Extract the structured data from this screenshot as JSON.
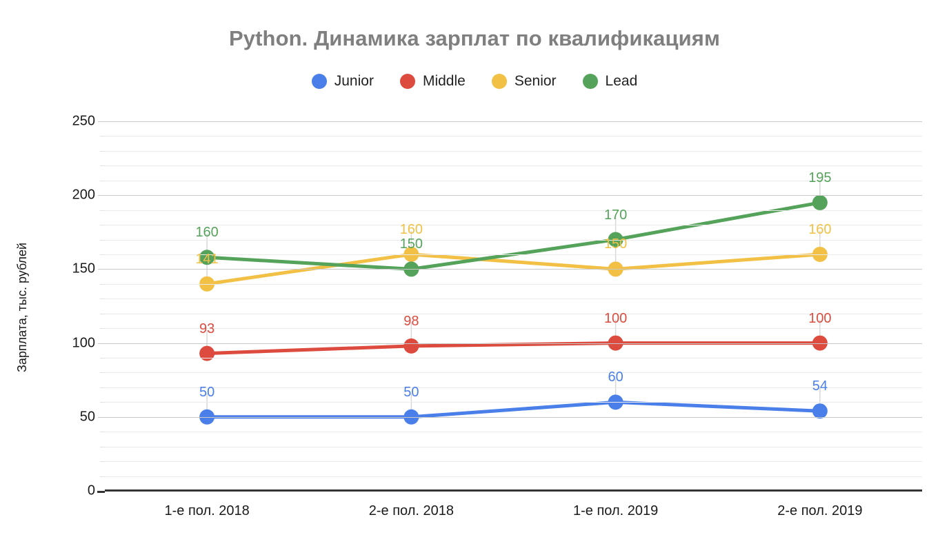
{
  "chart_data": {
    "type": "line",
    "title": "Python. Динамика зарплат по квалификациям",
    "xlabel": "",
    "ylabel": "Зарплата, тыс. рублей",
    "ylim": [
      0,
      250
    ],
    "ytick_step": 50,
    "yticks": [
      "0",
      "50",
      "100",
      "150",
      "200",
      "250"
    ],
    "minor_grid_step": 10,
    "grid": true,
    "legend_position": "top-center",
    "categories": [
      "1-е пол. 2018",
      "2-е пол. 2018",
      "1-е пол. 2019",
      "2-е пол. 2019"
    ],
    "series": [
      {
        "name": "Junior",
        "color": "#4a7fea",
        "values": [
          50,
          50,
          60,
          54
        ],
        "labels": [
          "50",
          "50",
          "60",
          "54"
        ]
      },
      {
        "name": "Middle",
        "color": "#dc4b3e",
        "values": [
          93,
          98,
          100,
          100
        ],
        "labels": [
          "93",
          "98",
          "100",
          "100"
        ]
      },
      {
        "name": "Senior",
        "color": "#f2c044",
        "values": [
          140,
          160,
          150,
          160
        ],
        "labels": [
          "141",
          "160",
          "150",
          "160"
        ]
      },
      {
        "name": "Lead",
        "color": "#55a35b",
        "values": [
          158,
          150,
          170,
          195
        ],
        "labels": [
          "160",
          "150",
          "170",
          "195"
        ]
      }
    ]
  },
  "colors": {
    "title": "#7f7f7f",
    "axis_text": "#1a1a1a",
    "grid_minor": "#eaeaea",
    "grid_major": "#c8c8c8",
    "axis_line": "#333333",
    "background": "#ffffff"
  }
}
